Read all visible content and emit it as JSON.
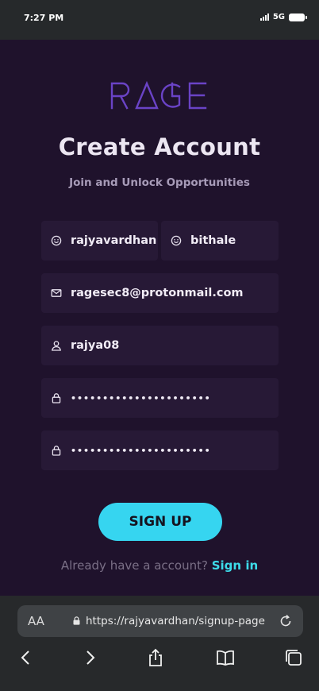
{
  "status": {
    "time": "7:27 PM",
    "network": "5G"
  },
  "brand": {
    "logo_text": "RAGE",
    "color": "#6a43c6"
  },
  "header": {
    "title": "Create Account",
    "subtitle": "Join and Unlock Opportunities"
  },
  "form": {
    "first_name": {
      "value": "rajyavardhan",
      "icon": "smile-icon"
    },
    "last_name": {
      "value": "bithale",
      "icon": "smile-icon"
    },
    "email": {
      "value": "ragesec8@protonmail.com",
      "icon": "mail-icon"
    },
    "username": {
      "value": "rajya08",
      "icon": "user-icon"
    },
    "password": {
      "value": "••••••••••••••••••••••",
      "icon": "lock-icon"
    },
    "confirm_password": {
      "value": "••••••••••••••••••••••",
      "icon": "lock-icon"
    },
    "signup_label": "SIGN UP",
    "signin_prompt": "Already have a account?",
    "signin_link": "Sign in"
  },
  "browser": {
    "text_size_label": "AA",
    "url": "https://rajyavardhan/signup-page",
    "toolbar": [
      "back-icon",
      "forward-icon",
      "share-icon",
      "bookmarks-icon",
      "tabs-icon"
    ]
  },
  "colors": {
    "accent": "#36d5f0",
    "link": "#3ddbe9",
    "background": "#1f122c",
    "field": "#271936"
  }
}
